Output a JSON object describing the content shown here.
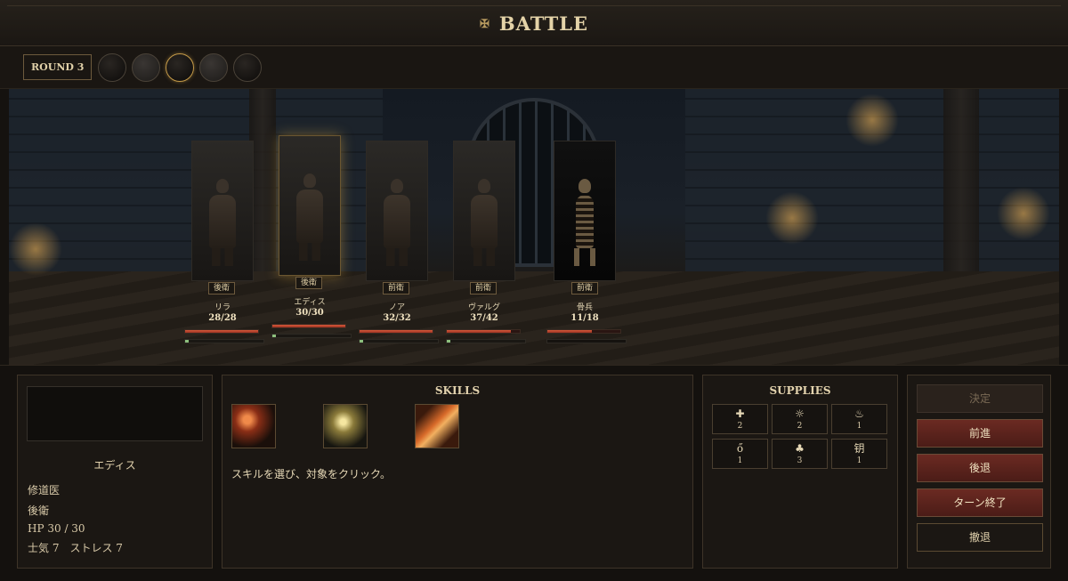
{
  "header": {
    "title": "BATTLE",
    "icon": "crossed-swords-icon"
  },
  "round": {
    "label": "ROUND 3",
    "turn_order_count": 5
  },
  "units": [
    {
      "name": "リラ",
      "rank": "後衛",
      "hp": "28/28",
      "hp_fraction": 1.0,
      "side": "hero"
    },
    {
      "name": "エディス",
      "rank": "後衛",
      "hp": "30/30",
      "hp_fraction": 1.0,
      "side": "hero",
      "selected": true
    },
    {
      "name": "ノア",
      "rank": "前衛",
      "hp": "32/32",
      "hp_fraction": 1.0,
      "side": "hero"
    },
    {
      "name": "ヴァルグ",
      "rank": "前衛",
      "hp": "37/42",
      "hp_fraction": 0.88,
      "side": "hero"
    },
    {
      "name": "骨兵",
      "rank": "前衛",
      "hp": "11/18",
      "hp_fraction": 0.61,
      "side": "enemy"
    }
  ],
  "info": {
    "name": "エディス",
    "class": "修道医",
    "rank": "後衛",
    "hp": "HP 30 / 30",
    "stats": "士気 7　ストレス 7"
  },
  "skills": {
    "title": "SKILLS",
    "hint": "スキルを選び、対象をクリック。"
  },
  "supplies": {
    "title": "SUPPLIES",
    "items": [
      {
        "icon": "✚",
        "count": "2"
      },
      {
        "icon": "☼",
        "count": "2"
      },
      {
        "icon": "♨",
        "count": "1"
      },
      {
        "icon": "ő",
        "count": "1"
      },
      {
        "icon": "♣",
        "count": "3"
      },
      {
        "icon": "钥",
        "count": "1"
      }
    ]
  },
  "actions": {
    "confirm": "決定",
    "advance": "前進",
    "retreat": "後退",
    "end_turn": "ターン終了",
    "withdraw": "撤退"
  }
}
